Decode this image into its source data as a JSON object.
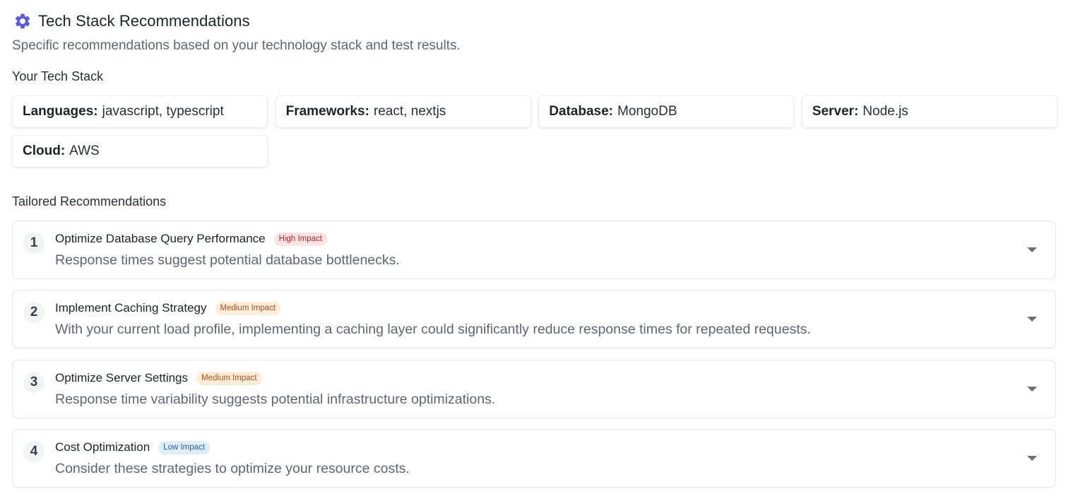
{
  "header": {
    "icon": "gear-icon",
    "title": "Tech Stack Recommendations",
    "subtitle": "Specific recommendations based on your technology stack and test results."
  },
  "tech_stack": {
    "label": "Your Tech Stack",
    "items": [
      {
        "key": "Languages:",
        "value": "javascript, typescript"
      },
      {
        "key": "Frameworks:",
        "value": "react, nextjs"
      },
      {
        "key": "Database:",
        "value": "MongoDB"
      },
      {
        "key": "Server:",
        "value": "Node.js"
      },
      {
        "key": "Cloud:",
        "value": "AWS"
      }
    ]
  },
  "recommendations": {
    "label": "Tailored Recommendations",
    "items": [
      {
        "number": "1",
        "title": "Optimize Database Query Performance",
        "impact": "High Impact",
        "level": "high",
        "description": "Response times suggest potential database bottlenecks."
      },
      {
        "number": "2",
        "title": "Implement Caching Strategy",
        "impact": "Medium Impact",
        "level": "medium",
        "description": "With your current load profile, implementing a caching layer could significantly reduce response times for repeated requests."
      },
      {
        "number": "3",
        "title": "Optimize Server Settings",
        "impact": "Medium Impact",
        "level": "medium",
        "description": "Response time variability suggests potential infrastructure optimizations."
      },
      {
        "number": "4",
        "title": "Cost Optimization",
        "impact": "Low Impact",
        "level": "low",
        "description": "Consider these strategies to optimize your resource costs."
      }
    ]
  },
  "colors": {
    "accent": "#5b5bd6",
    "high_bg": "#fde3e3",
    "high_text": "#b3262e",
    "medium_bg": "#feecd9",
    "medium_text": "#a8511a",
    "low_bg": "#e0eefc",
    "low_text": "#2661a8"
  }
}
